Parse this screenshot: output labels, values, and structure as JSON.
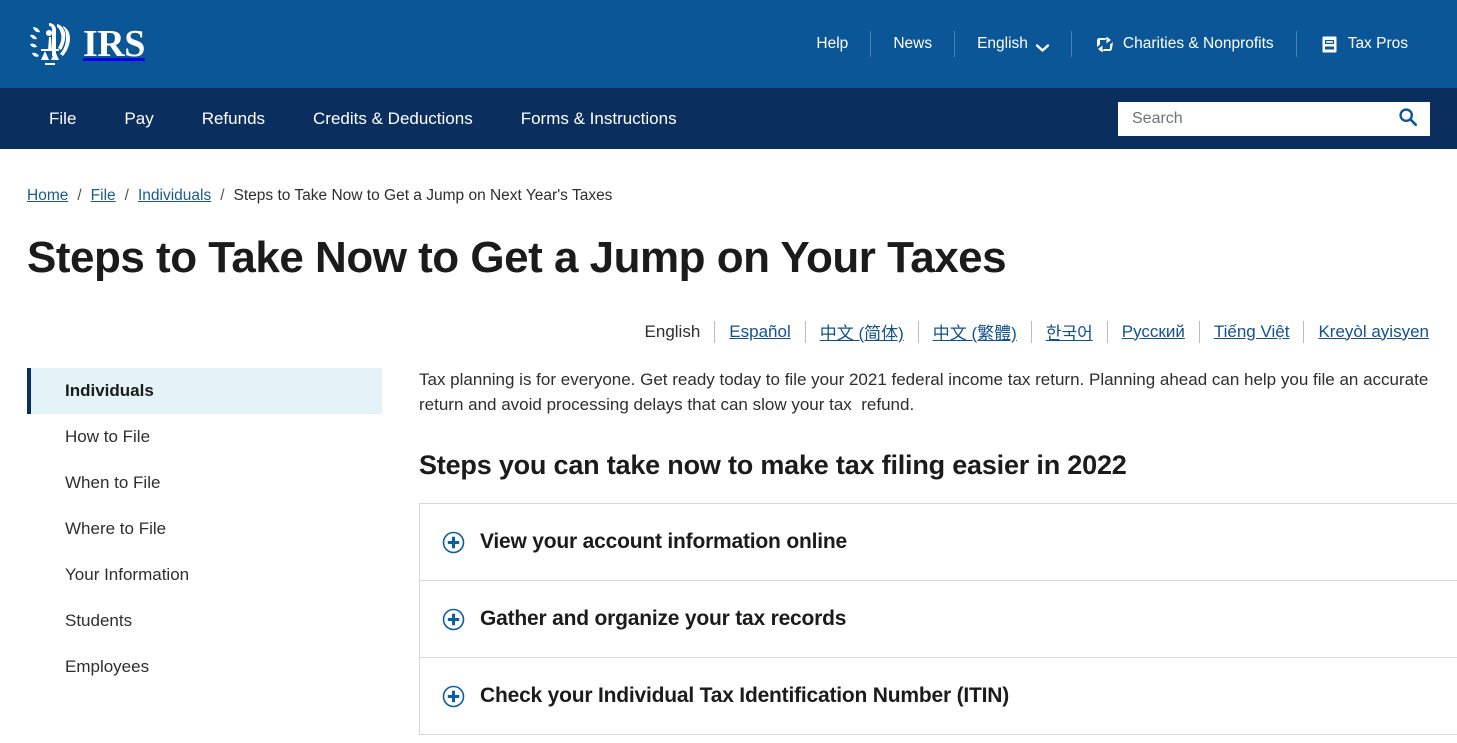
{
  "utility": {
    "logo_alt": "IRS",
    "logo_text": "IRS",
    "items": [
      {
        "label": "Help",
        "icon": null
      },
      {
        "label": "News",
        "icon": null
      },
      {
        "label": "English",
        "icon": "chevron-down-icon"
      },
      {
        "label": "Charities & Nonprofits",
        "icon": "charities-icon"
      },
      {
        "label": "Tax Pros",
        "icon": "tax-pros-icon"
      }
    ]
  },
  "mainnav": {
    "items": [
      {
        "label": "File"
      },
      {
        "label": "Pay"
      },
      {
        "label": "Refunds"
      },
      {
        "label": "Credits & Deductions"
      },
      {
        "label": "Forms & Instructions"
      }
    ]
  },
  "search": {
    "placeholder": "Search",
    "value": "",
    "icon": "search-icon"
  },
  "breadcrumb": {
    "items": [
      {
        "label": "Home",
        "link": true
      },
      {
        "label": "File",
        "link": true
      },
      {
        "label": "Individuals",
        "link": true
      },
      {
        "label": "Steps to Take Now to Get a Jump on Next Year's Taxes",
        "link": false
      }
    ],
    "separator": "/"
  },
  "page": {
    "title": "Steps to Take Now to Get a Jump on Your Taxes"
  },
  "languages": {
    "current": "English",
    "options": [
      "Español",
      "中文 (简体)",
      "中文 (繁體)",
      "한국어",
      "Русский",
      "Tiếng Việt",
      "Kreyòl ayisyen"
    ]
  },
  "sidebar": {
    "items": [
      {
        "label": "Individuals",
        "active": true
      },
      {
        "label": "How to File",
        "active": false
      },
      {
        "label": "When to File",
        "active": false
      },
      {
        "label": "Where to File",
        "active": false
      },
      {
        "label": "Your Information",
        "active": false
      },
      {
        "label": "Students",
        "active": false
      },
      {
        "label": "Employees",
        "active": false
      }
    ]
  },
  "main": {
    "intro": "Tax planning is for everyone. Get ready today to file your 2021 federal income tax return. Planning ahead can help you file an accurate return and avoid processing delays that can slow your tax  refund.",
    "section_heading": "Steps you can take now to make tax filing easier in 2022",
    "accordion": [
      {
        "label": "View your account information online",
        "icon": "plus-circle-icon",
        "expanded": false
      },
      {
        "label": "Gather and organize your tax records",
        "icon": "plus-circle-icon",
        "expanded": false
      },
      {
        "label": "Check your Individual Tax Identification Number (ITIN)",
        "icon": "plus-circle-icon",
        "expanded": false
      }
    ]
  },
  "colors": {
    "utility_bar": "#0b5697",
    "main_nav": "#0a2f5e",
    "link": "#14528c",
    "accent_icon": "#0a5ea1",
    "sidebar_active_bg": "#e3f3f7",
    "sidebar_active_border": "#0a2f5e"
  }
}
